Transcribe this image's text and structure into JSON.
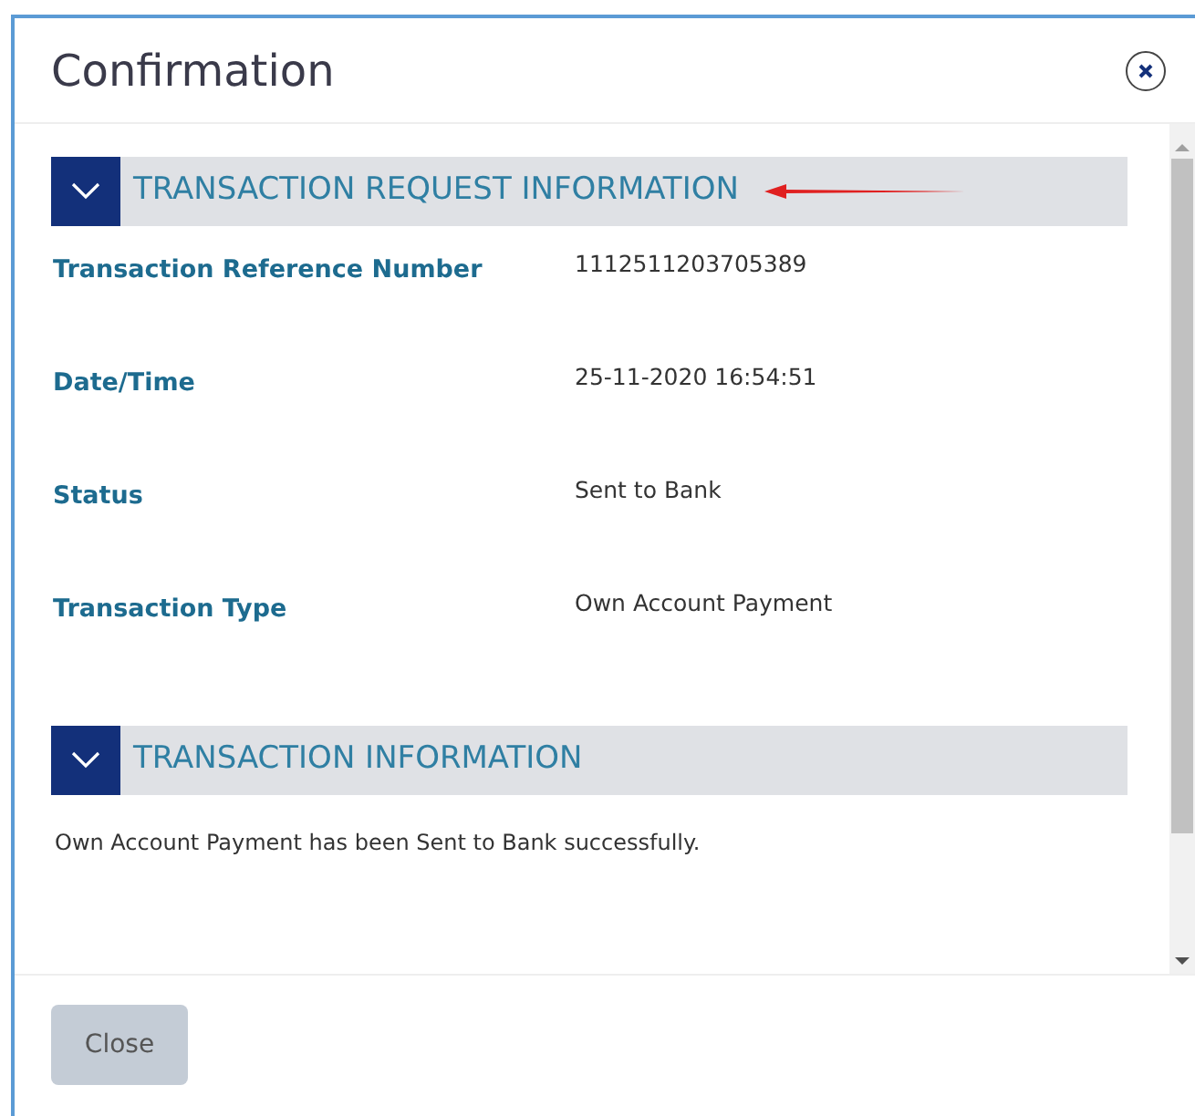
{
  "dialog": {
    "title": "Confirmation"
  },
  "sections": [
    {
      "title": "TRANSACTION REQUEST INFORMATION",
      "expanded": true,
      "annotated": true,
      "fields": [
        {
          "label": "Transaction Reference Number",
          "value": "1112511203705389"
        },
        {
          "label": "Date/Time",
          "value": "25-11-2020 16:54:51"
        },
        {
          "label": "Status",
          "value": "Sent to Bank"
        },
        {
          "label": "Transaction Type",
          "value": "Own Account Payment"
        }
      ]
    },
    {
      "title": "TRANSACTION INFORMATION",
      "expanded": true,
      "annotated": false,
      "message": "Own Account Payment has been Sent to Bank successfully."
    }
  ],
  "buttons": [
    {
      "label": "Close",
      "disabled": true
    }
  ]
}
